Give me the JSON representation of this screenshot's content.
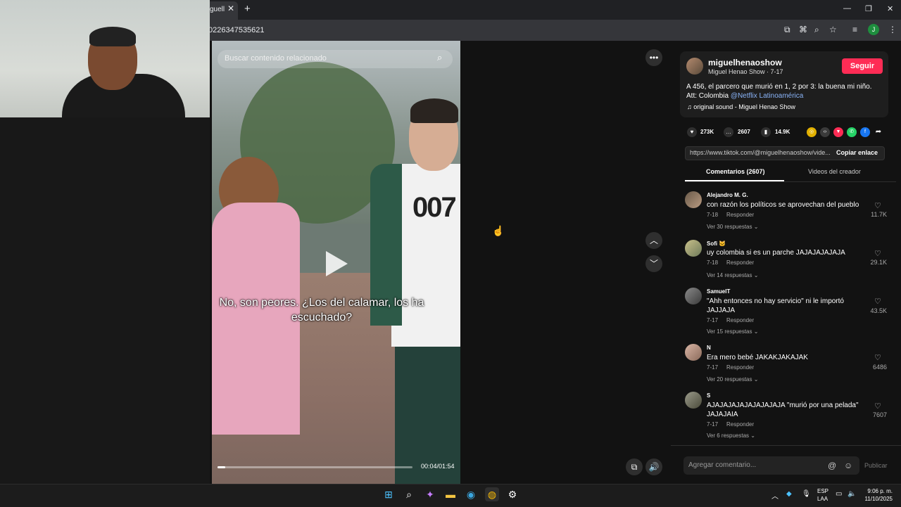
{
  "browser": {
    "tab_title": "guell",
    "tab_close": "✕",
    "new_tab": "+",
    "url": "0226347535621",
    "profile_initial": "J",
    "window": {
      "minimize": "—",
      "restore": "❐",
      "close": "✕"
    }
  },
  "video": {
    "search_placeholder": "Buscar contenido relacionado",
    "subtitle": "No, son peores. ¿Los del calamar, los ha escuchado?",
    "shirt_number": "007",
    "time": "00:04/01:54",
    "progress_fraction": 0.04,
    "more_label": "•••"
  },
  "post": {
    "username": "miguelhenaoshow",
    "subtitle": "Miguel Henao Show · 7-17",
    "follow_label": "Seguir",
    "description": "A 456, el parcero que murió en 1, 2 por 3: la buena mi niño. Att: Colombia ",
    "mention": "@Netflix Latinoamérica",
    "sound": "original sound - Miguel Henao Show",
    "likes": "273K",
    "comments": "2607",
    "saves": "14.9K",
    "link": "https://www.tiktok.com/@miguelhenaoshow/vide...",
    "copy_label": "Copiar enlace",
    "tab_comments": "Comentarios (2607)",
    "tab_videos": "Videos del creador"
  },
  "comments": [
    {
      "user": "Alejandro M. G.",
      "text": "con razón los políticos se aprovechan del pueblo",
      "date": "7-18",
      "reply": "Responder",
      "more": "Ver 30 respuestas ⌄",
      "likes": "11.7K"
    },
    {
      "user": "Sofi 🐱",
      "text": "uy colombia si es un parche JAJAJAJAJAJA",
      "date": "7-18",
      "reply": "Responder",
      "more": "Ver 14 respuestas ⌄",
      "likes": "29.1K"
    },
    {
      "user": "SamuelT",
      "text": "\"Ahh entonces no hay servicio\" ni le importó JAJJAJA",
      "date": "7-17",
      "reply": "Responder",
      "more": "Ver 15 respuestas ⌄",
      "likes": "43.5K"
    },
    {
      "user": "N",
      "text": "Era mero bebé JAKAKJAKAJAK",
      "date": "7-17",
      "reply": "Responder",
      "more": "Ver 20 respuestas ⌄",
      "likes": "6486"
    },
    {
      "user": "S",
      "text": "AJAJAJAJAJAJAJAJAJA \"murió por una pelada\" JAJAJAIA",
      "date": "7-17",
      "reply": "Responder",
      "more": "Ver 6 respuestas ⌄",
      "likes": "7607"
    }
  ],
  "composer": {
    "placeholder": "Agregar comentario...",
    "publish_label": "Publicar"
  },
  "taskbar": {
    "lang1": "ESP",
    "lang2": "LAA",
    "time": "9:06 p. m.",
    "date": "11/10/2025"
  },
  "colors": {
    "accent": "#fe2c55",
    "mention": "#8ab4f8"
  }
}
